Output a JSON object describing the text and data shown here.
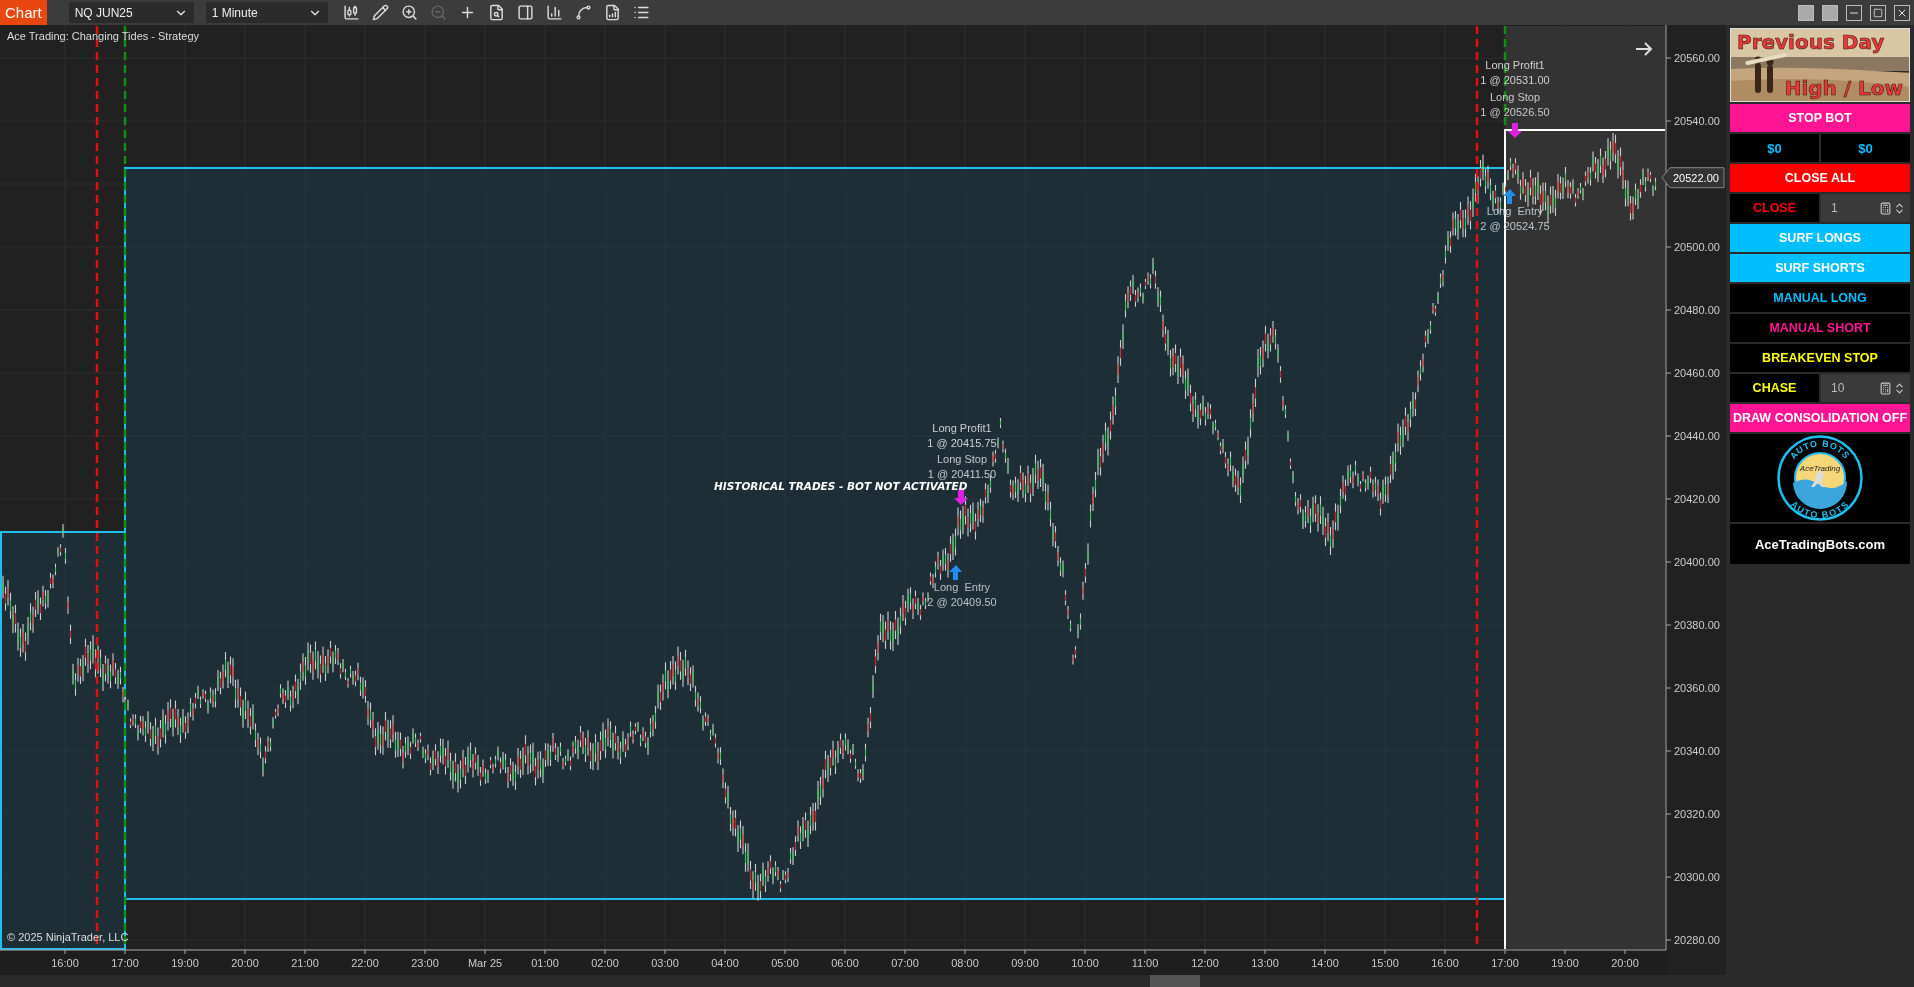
{
  "toolbar": {
    "app_label": "Chart",
    "instrument": "NQ JUN25",
    "interval": "1 Minute"
  },
  "chart": {
    "title": "Ace Trading: Changing Tides - Strategy",
    "copyright": "© 2025 NinjaTrader, LLC",
    "banner": "HISTORICAL TRADES - BOT NOT ACTIVATED",
    "trade_labels": [
      {
        "kind": "profit",
        "name": "Long Profit1",
        "detail": "1 @ 20415.75"
      },
      {
        "kind": "stop",
        "name": "Long Stop",
        "detail": "1 @ 20411.50"
      },
      {
        "kind": "entry",
        "name": "Long  Entry",
        "detail": "2 @ 20409.50"
      },
      {
        "kind": "profit",
        "name": "Long Profit1",
        "detail": "1 @ 20531.00"
      },
      {
        "kind": "stop",
        "name": "Long Stop",
        "detail": "1 @ 20526.50"
      },
      {
        "kind": "entry",
        "name": "Long  Entry",
        "detail": "2 @ 20524.75"
      }
    ],
    "price_axis": {
      "ticks": [
        "20560.00",
        "20540.00",
        "20500.00",
        "20480.00",
        "20460.00",
        "20440.00",
        "20420.00",
        "20400.00",
        "20380.00",
        "20360.00",
        "20340.00",
        "20320.00",
        "20300.00",
        "20280.00"
      ],
      "last_price": "20522.00"
    },
    "time_axis": {
      "ticks": [
        "16:00",
        "17:00",
        "19:00",
        "20:00",
        "21:00",
        "22:00",
        "23:00",
        "Mar 25",
        "01:00",
        "02:00",
        "03:00",
        "04:00",
        "05:00",
        "06:00",
        "07:00",
        "08:00",
        "09:00",
        "10:00",
        "11:00",
        "12:00",
        "13:00",
        "14:00",
        "15:00",
        "16:00",
        "17:00",
        "19:00",
        "20:00"
      ]
    }
  },
  "panel": {
    "banner": {
      "title": "Previous Day",
      "subtitle": "High / Low"
    },
    "items": [
      {
        "kind": "fill",
        "label": "STOP BOT",
        "color": "#ff1493"
      },
      {
        "kind": "pair",
        "values": [
          "$0",
          "$0"
        ],
        "color": "#00bfff"
      },
      {
        "kind": "fill",
        "label": "CLOSE ALL",
        "color": "#ff0000"
      },
      {
        "kind": "spinner",
        "label": "CLOSE",
        "value": "1",
        "color": "#ff0000"
      },
      {
        "kind": "fill",
        "label": "SURF LONGS",
        "color": "#00bfff"
      },
      {
        "kind": "fill",
        "label": "SURF SHORTS",
        "color": "#00bfff"
      },
      {
        "kind": "dark",
        "label": "MANUAL LONG",
        "color": "#00bfff"
      },
      {
        "kind": "dark",
        "label": "MANUAL SHORT",
        "color": "#ff1493"
      },
      {
        "kind": "dark",
        "label": "BREAKEVEN STOP",
        "color": "#ffff00"
      },
      {
        "kind": "spinner",
        "label": "CHASE",
        "value": "10",
        "color": "#ffff00"
      },
      {
        "kind": "fill",
        "label": "DRAW CONSOLIDATION OFF",
        "color": "#ff1493"
      },
      {
        "kind": "logo",
        "ring_top": "AUTO BOTS",
        "ring_bottom": "AUTO BOTS",
        "center": "AceTrading"
      },
      {
        "kind": "link",
        "label": "AceTradingBots.com",
        "color": "#ffffff"
      }
    ]
  }
}
